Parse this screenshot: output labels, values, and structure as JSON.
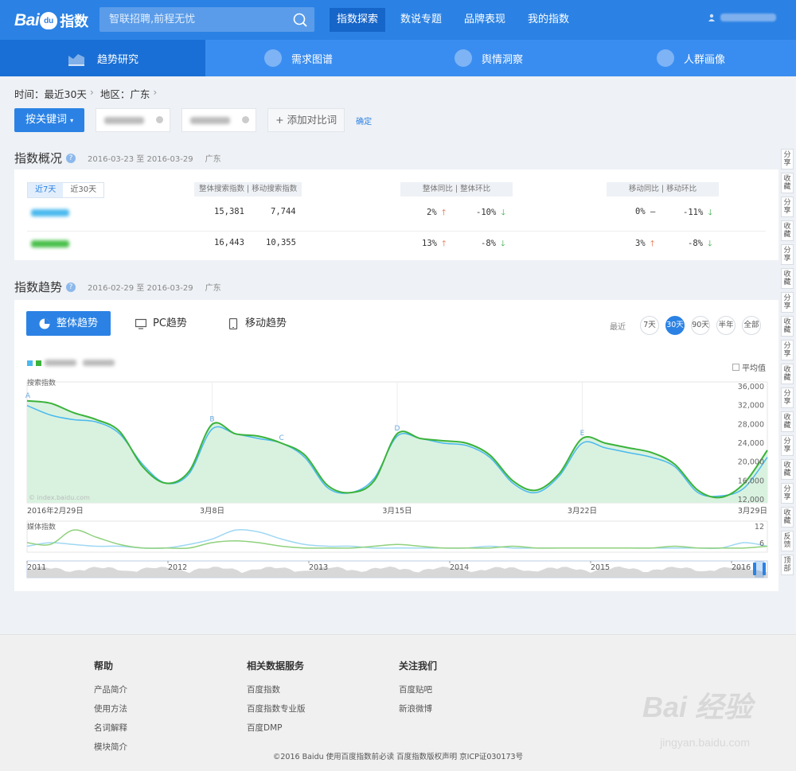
{
  "header": {
    "logo_text": "Bai",
    "logo_paw": "du",
    "logo_suffix": "指数",
    "search_placeholder": "智联招聘,前程无忧",
    "nav": [
      {
        "label": "指数探索",
        "active": true
      },
      {
        "label": "数说专题",
        "active": false
      },
      {
        "label": "品牌表现",
        "active": false
      },
      {
        "label": "我的指数",
        "active": false
      }
    ]
  },
  "subnav": [
    {
      "label": "趋势研究",
      "active": true
    },
    {
      "label": "需求图谱",
      "active": false
    },
    {
      "label": "舆情洞察",
      "active": false
    },
    {
      "label": "人群画像",
      "active": false
    }
  ],
  "filters": {
    "time_label": "时间：最近30天",
    "region_label": "地区：广东",
    "keyword_button": "按关键词",
    "add_compare": "+ 添加对比词",
    "confirm": "确定"
  },
  "overview": {
    "title": "指数概况",
    "date_range": "2016-03-23 至 2016-03-29",
    "region": "广东",
    "tabs": [
      "近7天",
      "近30天"
    ],
    "col_headers": {
      "index": "整体搜索指数 | 移动搜索指数",
      "overall_change": "整体同比 | 整体环比",
      "mobile_change": "移动同比 | 移动环比"
    },
    "rows": [
      {
        "color": "#4ab9ee",
        "total": "15,381",
        "mobile": "7,744",
        "yoy": "2%",
        "yoy_dir": "up",
        "mom": "-10%",
        "mom_dir": "down",
        "m_yoy": "0%",
        "m_yoy_dir": "flat",
        "m_mom": "-11%",
        "m_mom_dir": "down"
      },
      {
        "color": "#49c04b",
        "total": "16,443",
        "mobile": "10,355",
        "yoy": "13%",
        "yoy_dir": "up",
        "mom": "-8%",
        "mom_dir": "down",
        "m_yoy": "3%",
        "m_yoy_dir": "up",
        "m_mom": "-8%",
        "m_mom_dir": "down"
      }
    ]
  },
  "trend": {
    "title": "指数趋势",
    "date_range": "2016-02-29 至 2016-03-29",
    "region": "广东",
    "buttons": [
      "整体趋势",
      "PC趋势",
      "移动趋势"
    ],
    "range_label": "最近",
    "ranges": [
      {
        "label": "7天",
        "active": false
      },
      {
        "label": "30天",
        "active": true
      },
      {
        "label": "90天",
        "active": false
      },
      {
        "label": "半年",
        "active": false
      },
      {
        "label": "全部",
        "active": false
      }
    ],
    "average_label": "平均值",
    "series_colors": {
      "a": "#4ab9ee",
      "b": "#3bb33b"
    },
    "watermark": "© index.baidu.com"
  },
  "chart_data": [
    {
      "type": "line",
      "ylabel": "搜索指数",
      "ylim": [
        12000,
        36000
      ],
      "yticks": [
        "36,000",
        "32,000",
        "28,000",
        "24,000",
        "20,000",
        "16,000",
        "12,000"
      ],
      "xticks": [
        "2016年2月29日",
        "3月8日",
        "3月15日",
        "3月22日",
        "3月29日"
      ],
      "annotations": [
        "A",
        "B",
        "C",
        "D",
        "E"
      ],
      "series": [
        {
          "color": "#4ab9ee",
          "values": [
            32000,
            30000,
            29000,
            28500,
            26000,
            19500,
            15500,
            17500,
            27000,
            26000,
            25000,
            24000,
            21000,
            14500,
            13500,
            16500,
            25500,
            25000,
            24000,
            23500,
            21000,
            15500,
            13500,
            17000,
            24000,
            23000,
            22000,
            21000,
            19000,
            13500,
            12800,
            14500,
            21000
          ]
        },
        {
          "color": "#3bb33b",
          "values": [
            33000,
            32500,
            30500,
            29000,
            26500,
            19000,
            15500,
            18000,
            28000,
            26000,
            25500,
            24000,
            21500,
            15000,
            13500,
            16000,
            26000,
            25000,
            24500,
            24000,
            21500,
            16000,
            14000,
            17500,
            25000,
            24000,
            23000,
            22000,
            19500,
            14000,
            12500,
            15500,
            22500
          ]
        }
      ]
    },
    {
      "type": "line",
      "ylabel": "媒体指数",
      "yticks": [
        "12",
        "6"
      ],
      "series": [
        {
          "color": "#9fd8f2",
          "values": [
            2,
            4,
            3,
            2,
            2,
            1,
            1,
            3,
            6,
            11,
            10,
            6,
            3,
            2,
            2,
            1,
            1,
            1,
            1,
            1,
            2,
            1,
            1,
            1,
            1,
            1,
            1,
            1,
            1,
            1,
            1,
            4,
            2
          ]
        },
        {
          "color": "#8fd17d",
          "values": [
            4,
            3,
            11,
            7,
            3,
            1,
            1,
            1,
            4,
            5,
            4,
            2,
            1,
            1,
            1,
            2,
            3,
            2,
            1,
            1,
            1,
            2,
            1,
            1,
            1,
            1,
            1,
            1,
            2,
            1,
            1,
            1,
            2
          ]
        }
      ]
    }
  ],
  "timeline": {
    "years": [
      "2011",
      "2012",
      "2013",
      "2014",
      "2015",
      "2016"
    ]
  },
  "sidetools": [
    "分享",
    "收藏",
    "分享",
    "收藏",
    "分享",
    "收藏",
    "分享",
    "收藏",
    "分享",
    "收藏",
    "分享",
    "收藏",
    "分享",
    "收藏",
    "分享",
    "收藏",
    "反馈",
    "顶部"
  ],
  "footer": {
    "columns": [
      {
        "title": "帮助",
        "links": [
          "产品简介",
          "使用方法",
          "名词解释",
          "模块简介"
        ]
      },
      {
        "title": "相关数据服务",
        "links": [
          "百度指数",
          "百度指数专业版",
          "百度DMP"
        ]
      },
      {
        "title": "关注我们",
        "links": [
          "百度贴吧",
          "新浪微博"
        ]
      }
    ],
    "copyright": "©2016 Baidu  使用百度指数前必读   百度指数版权声明   京ICP证030173号"
  },
  "watermark": {
    "line1": "Bai 经验",
    "line2": "jingyan.baidu.com"
  }
}
